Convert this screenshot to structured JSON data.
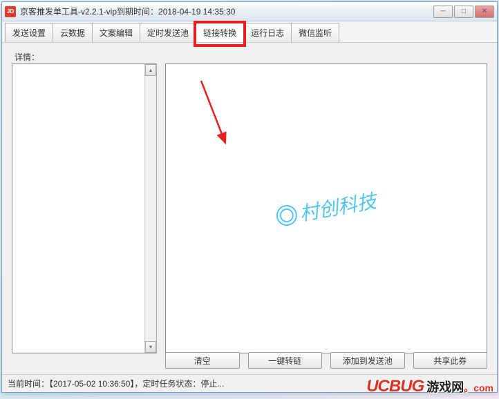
{
  "titlebar": {
    "icon_text": "JD",
    "title": "京客推发单工具-v2.2.1-vip到期时间：2018-04-19 14:35:30"
  },
  "tabs": {
    "items": [
      {
        "label": "发送设置"
      },
      {
        "label": "云数据"
      },
      {
        "label": "文案编辑"
      },
      {
        "label": "定时发送池"
      },
      {
        "label": "链接转换"
      },
      {
        "label": "运行日志"
      },
      {
        "label": "微信监听"
      }
    ],
    "active_index": 4,
    "highlighted_index": 4
  },
  "content": {
    "detail_label": "详情：",
    "watermark_text": "村创科技"
  },
  "buttons": {
    "clear": "清空",
    "convert": "一键转链",
    "add_pool": "添加到发送池",
    "share": "共享此券"
  },
  "statusbar": {
    "text": "当前时间：【2017-05-02 10:36:50】，定时任务状态：停止..."
  },
  "site_watermark": {
    "brand": "UCBUG",
    "cn": "游戏网",
    "com": "。com"
  }
}
